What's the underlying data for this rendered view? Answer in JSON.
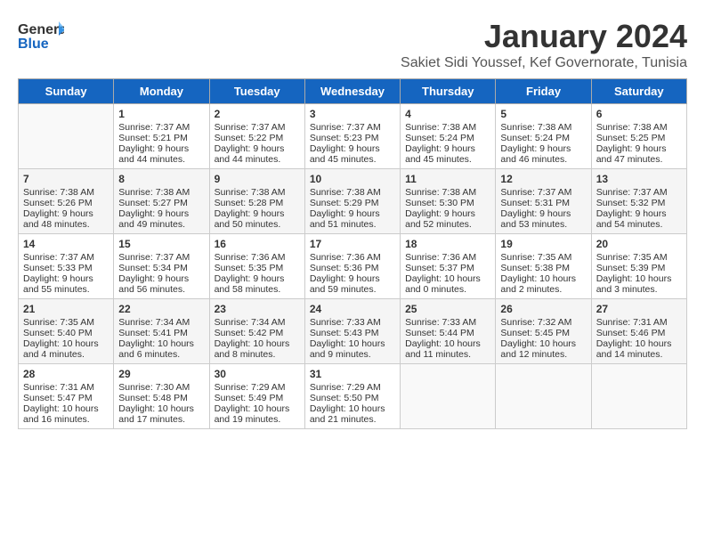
{
  "header": {
    "logo_line1": "General",
    "logo_line2": "Blue",
    "month": "January 2024",
    "location": "Sakiet Sidi Youssef, Kef Governorate, Tunisia"
  },
  "weekdays": [
    "Sunday",
    "Monday",
    "Tuesday",
    "Wednesday",
    "Thursday",
    "Friday",
    "Saturday"
  ],
  "weeks": [
    [
      {
        "day": "",
        "info": ""
      },
      {
        "day": "1",
        "info": "Sunrise: 7:37 AM\nSunset: 5:21 PM\nDaylight: 9 hours\nand 44 minutes."
      },
      {
        "day": "2",
        "info": "Sunrise: 7:37 AM\nSunset: 5:22 PM\nDaylight: 9 hours\nand 44 minutes."
      },
      {
        "day": "3",
        "info": "Sunrise: 7:37 AM\nSunset: 5:23 PM\nDaylight: 9 hours\nand 45 minutes."
      },
      {
        "day": "4",
        "info": "Sunrise: 7:38 AM\nSunset: 5:24 PM\nDaylight: 9 hours\nand 45 minutes."
      },
      {
        "day": "5",
        "info": "Sunrise: 7:38 AM\nSunset: 5:24 PM\nDaylight: 9 hours\nand 46 minutes."
      },
      {
        "day": "6",
        "info": "Sunrise: 7:38 AM\nSunset: 5:25 PM\nDaylight: 9 hours\nand 47 minutes."
      }
    ],
    [
      {
        "day": "7",
        "info": "Sunrise: 7:38 AM\nSunset: 5:26 PM\nDaylight: 9 hours\nand 48 minutes."
      },
      {
        "day": "8",
        "info": "Sunrise: 7:38 AM\nSunset: 5:27 PM\nDaylight: 9 hours\nand 49 minutes."
      },
      {
        "day": "9",
        "info": "Sunrise: 7:38 AM\nSunset: 5:28 PM\nDaylight: 9 hours\nand 50 minutes."
      },
      {
        "day": "10",
        "info": "Sunrise: 7:38 AM\nSunset: 5:29 PM\nDaylight: 9 hours\nand 51 minutes."
      },
      {
        "day": "11",
        "info": "Sunrise: 7:38 AM\nSunset: 5:30 PM\nDaylight: 9 hours\nand 52 minutes."
      },
      {
        "day": "12",
        "info": "Sunrise: 7:37 AM\nSunset: 5:31 PM\nDaylight: 9 hours\nand 53 minutes."
      },
      {
        "day": "13",
        "info": "Sunrise: 7:37 AM\nSunset: 5:32 PM\nDaylight: 9 hours\nand 54 minutes."
      }
    ],
    [
      {
        "day": "14",
        "info": "Sunrise: 7:37 AM\nSunset: 5:33 PM\nDaylight: 9 hours\nand 55 minutes."
      },
      {
        "day": "15",
        "info": "Sunrise: 7:37 AM\nSunset: 5:34 PM\nDaylight: 9 hours\nand 56 minutes."
      },
      {
        "day": "16",
        "info": "Sunrise: 7:36 AM\nSunset: 5:35 PM\nDaylight: 9 hours\nand 58 minutes."
      },
      {
        "day": "17",
        "info": "Sunrise: 7:36 AM\nSunset: 5:36 PM\nDaylight: 9 hours\nand 59 minutes."
      },
      {
        "day": "18",
        "info": "Sunrise: 7:36 AM\nSunset: 5:37 PM\nDaylight: 10 hours\nand 0 minutes."
      },
      {
        "day": "19",
        "info": "Sunrise: 7:35 AM\nSunset: 5:38 PM\nDaylight: 10 hours\nand 2 minutes."
      },
      {
        "day": "20",
        "info": "Sunrise: 7:35 AM\nSunset: 5:39 PM\nDaylight: 10 hours\nand 3 minutes."
      }
    ],
    [
      {
        "day": "21",
        "info": "Sunrise: 7:35 AM\nSunset: 5:40 PM\nDaylight: 10 hours\nand 4 minutes."
      },
      {
        "day": "22",
        "info": "Sunrise: 7:34 AM\nSunset: 5:41 PM\nDaylight: 10 hours\nand 6 minutes."
      },
      {
        "day": "23",
        "info": "Sunrise: 7:34 AM\nSunset: 5:42 PM\nDaylight: 10 hours\nand 8 minutes."
      },
      {
        "day": "24",
        "info": "Sunrise: 7:33 AM\nSunset: 5:43 PM\nDaylight: 10 hours\nand 9 minutes."
      },
      {
        "day": "25",
        "info": "Sunrise: 7:33 AM\nSunset: 5:44 PM\nDaylight: 10 hours\nand 11 minutes."
      },
      {
        "day": "26",
        "info": "Sunrise: 7:32 AM\nSunset: 5:45 PM\nDaylight: 10 hours\nand 12 minutes."
      },
      {
        "day": "27",
        "info": "Sunrise: 7:31 AM\nSunset: 5:46 PM\nDaylight: 10 hours\nand 14 minutes."
      }
    ],
    [
      {
        "day": "28",
        "info": "Sunrise: 7:31 AM\nSunset: 5:47 PM\nDaylight: 10 hours\nand 16 minutes."
      },
      {
        "day": "29",
        "info": "Sunrise: 7:30 AM\nSunset: 5:48 PM\nDaylight: 10 hours\nand 17 minutes."
      },
      {
        "day": "30",
        "info": "Sunrise: 7:29 AM\nSunset: 5:49 PM\nDaylight: 10 hours\nand 19 minutes."
      },
      {
        "day": "31",
        "info": "Sunrise: 7:29 AM\nSunset: 5:50 PM\nDaylight: 10 hours\nand 21 minutes."
      },
      {
        "day": "",
        "info": ""
      },
      {
        "day": "",
        "info": ""
      },
      {
        "day": "",
        "info": ""
      }
    ]
  ]
}
